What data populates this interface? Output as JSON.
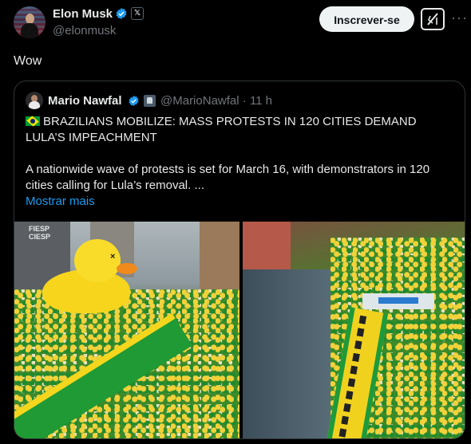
{
  "tweet": {
    "author_name": "Elon Musk",
    "author_handle": "@elonmusk",
    "subscribe_label": "Inscrever-se",
    "x_badge": "𝕏",
    "more_icon": "···",
    "text": "Wow"
  },
  "quote": {
    "author_name": "Mario Nawfal",
    "author_handle": "@MarioNawfal",
    "separator": "·",
    "time": "11 h",
    "headline": "BRAZILIANS MOBILIZE: MASS PROTESTS IN 120 CITIES DEMAND LULA’S IMPEACHMENT",
    "body": "A nationwide wave of protests is set for March 16, with demonstrators in 120 cities calling for Lula’s removal. ...",
    "show_more": "Mostrar mais",
    "left_image_sign": "FIESP CIESP"
  },
  "colors": {
    "background": "#000000",
    "text": "#e7e9ea",
    "muted": "#71767b",
    "link": "#1d9bf0",
    "verified": "#1d9bf0",
    "border": "#2f3336"
  }
}
